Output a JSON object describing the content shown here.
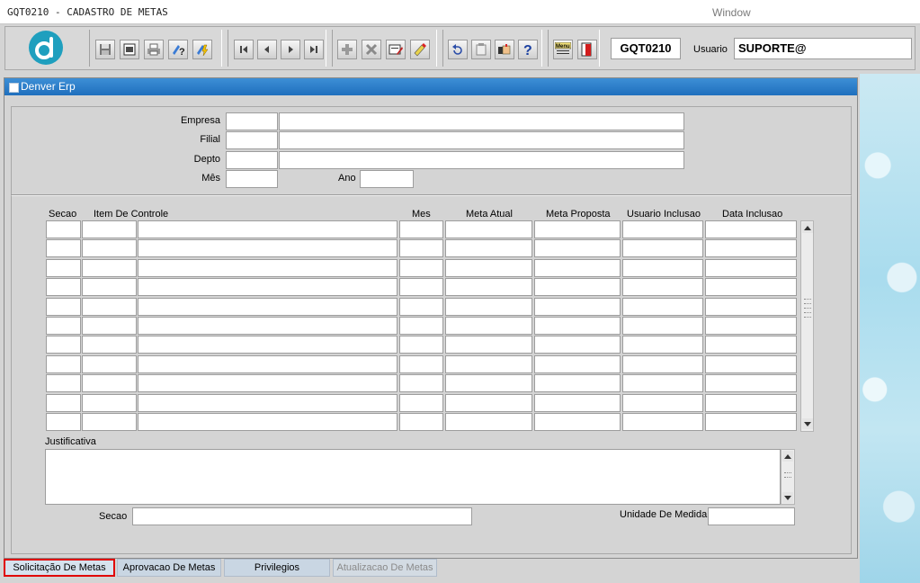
{
  "window": {
    "title": "GQT0210 - CADASTRO DE METAS",
    "menu_label": "Window"
  },
  "toolbar": {
    "logo_letter": "d",
    "module_code": "GQT0210",
    "user_label": "Usuario",
    "user_value": "SUPORTE@",
    "button_icons": [
      "save-icon",
      "window-icon",
      "print-icon",
      "query-help-icon",
      "execute-query-icon",
      "first-record-icon",
      "previous-record-icon",
      "next-record-icon",
      "last-record-icon",
      "insert-record-icon",
      "delete-record-icon",
      "edit-record-icon",
      "clear-record-icon",
      "undo-icon",
      "clipboard-icon",
      "hand-icon",
      "help-icon",
      "menu-icon",
      "exit-icon"
    ]
  },
  "form": {
    "title": "Denver Erp",
    "labels": {
      "empresa": "Empresa",
      "filial": "Filial",
      "depto": "Depto",
      "mes": "Mês",
      "ano": "Ano"
    },
    "grid": {
      "columns": [
        "Secao",
        "Item De Controle",
        "Mes",
        "Meta Atual",
        "Meta Proposta",
        "Usuario Inclusao",
        "Data Inclusao"
      ],
      "row_count": 11
    },
    "justificativa_label": "Justificativa",
    "secao_label": "Secao",
    "unidade_label": "Unidade De Medida"
  },
  "tabs": [
    {
      "label": "Solicitação De Metas",
      "state": "active"
    },
    {
      "label": "Aprovacao De Metas",
      "state": "normal"
    },
    {
      "label": "Privilegios",
      "state": "normal"
    },
    {
      "label": "Atualizacao De Metas",
      "state": "disabled"
    }
  ],
  "colors": {
    "form_title_bar": "#2a7cc9",
    "logo": "#1f9fbe",
    "active_tab_border": "#e00000",
    "side_panel": "#a9dcee"
  }
}
